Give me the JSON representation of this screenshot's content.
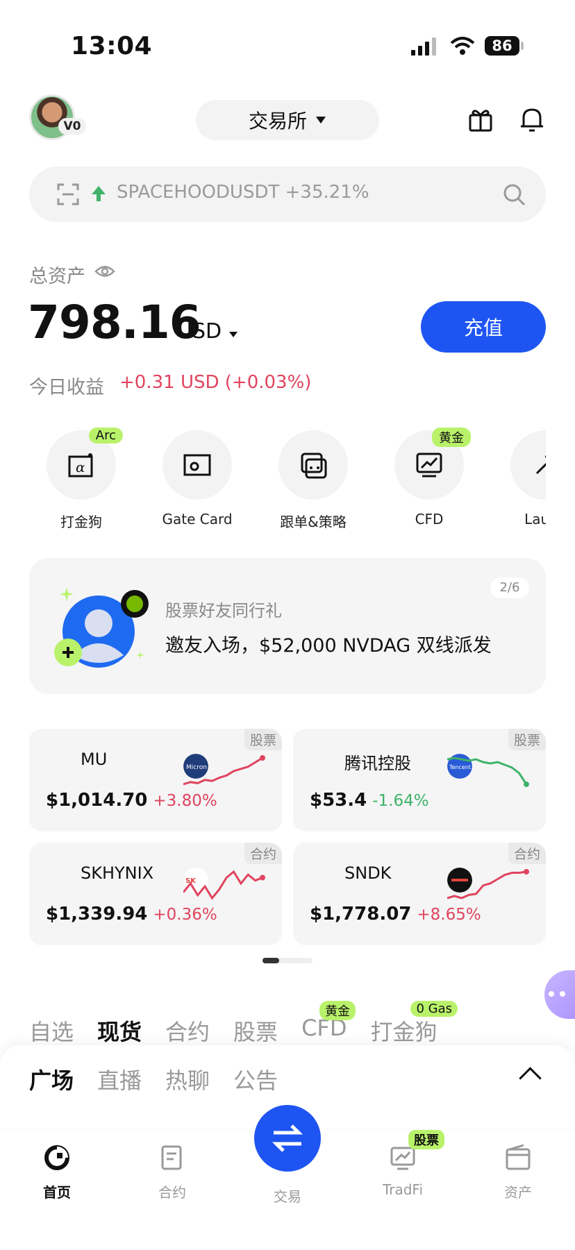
{
  "status_bar": {
    "time": "13:04",
    "battery": "86"
  },
  "header": {
    "vip": "V0",
    "exchange_label": "交易所"
  },
  "search": {
    "text": "SPACEHOODUSDT +35.21%"
  },
  "assets": {
    "total_label": "总资产",
    "amount": "798.16",
    "currency": "USD",
    "deposit_label": "充值",
    "today_label": "今日收益",
    "today_value": "+0.31 USD (+0.03%)"
  },
  "shortcuts": [
    {
      "label": "打金狗",
      "badge": "Arc",
      "icon": "alpha-icon"
    },
    {
      "label": "Gate Card",
      "badge": "",
      "icon": "card-icon"
    },
    {
      "label": "跟单&策略",
      "badge": "",
      "icon": "copy-trade-icon"
    },
    {
      "label": "CFD",
      "badge": "黄金",
      "icon": "chart-icon"
    },
    {
      "label": "Launc",
      "badge": "",
      "icon": "launch-icon"
    }
  ],
  "banner": {
    "subtitle": "股票好友同行礼",
    "title": "邀友入场，$52,000 NVDAG 双线派发",
    "pager": "2/6"
  },
  "cards": [
    {
      "name": "MU",
      "price": "$1,014.70",
      "change": "+3.80%",
      "tag": "股票",
      "trend": "up",
      "spark": [
        10,
        12,
        11,
        14,
        13,
        16,
        18,
        22,
        24,
        26,
        30,
        34
      ]
    },
    {
      "name": "腾讯控股",
      "price": "$53.4",
      "change": "-1.64%",
      "tag": "股票",
      "trend": "down",
      "spark": [
        30,
        31,
        30,
        29,
        30,
        28,
        27,
        28,
        26,
        24,
        20,
        12
      ]
    },
    {
      "name": "SKHYNIX",
      "price": "$1,339.94",
      "change": "+0.36%",
      "tag": "合约",
      "trend": "up",
      "spark": [
        16,
        22,
        14,
        20,
        12,
        18,
        26,
        30,
        22,
        28,
        24,
        26
      ]
    },
    {
      "name": "SNDK",
      "price": "$1,778.07",
      "change": "+8.65%",
      "tag": "合约",
      "trend": "up",
      "spark": [
        6,
        8,
        6,
        9,
        10,
        18,
        20,
        24,
        28,
        30,
        30,
        31
      ]
    }
  ],
  "market_tabs": [
    {
      "label": "自选",
      "badge": ""
    },
    {
      "label": "现货",
      "badge": ""
    },
    {
      "label": "合约",
      "badge": ""
    },
    {
      "label": "股票",
      "badge": ""
    },
    {
      "label": "CFD",
      "badge": "黄金"
    },
    {
      "label": "打金狗",
      "badge": "0 Gas"
    }
  ],
  "sheet_tabs": [
    "广场",
    "直播",
    "热聊",
    "公告"
  ],
  "bottom_nav": [
    {
      "label": "首页",
      "icon": "home-icon"
    },
    {
      "label": "合约",
      "icon": "contract-icon"
    },
    {
      "label": "交易",
      "icon": "swap-icon"
    },
    {
      "label": "TradFi",
      "icon": "tradfi-icon",
      "badge": "股票"
    },
    {
      "label": "资产",
      "icon": "wallet-icon"
    }
  ],
  "colors": {
    "brand": "#1e55f2",
    "up": "#e0445e",
    "down": "#3fb36b",
    "badge": "#b9f26a"
  }
}
